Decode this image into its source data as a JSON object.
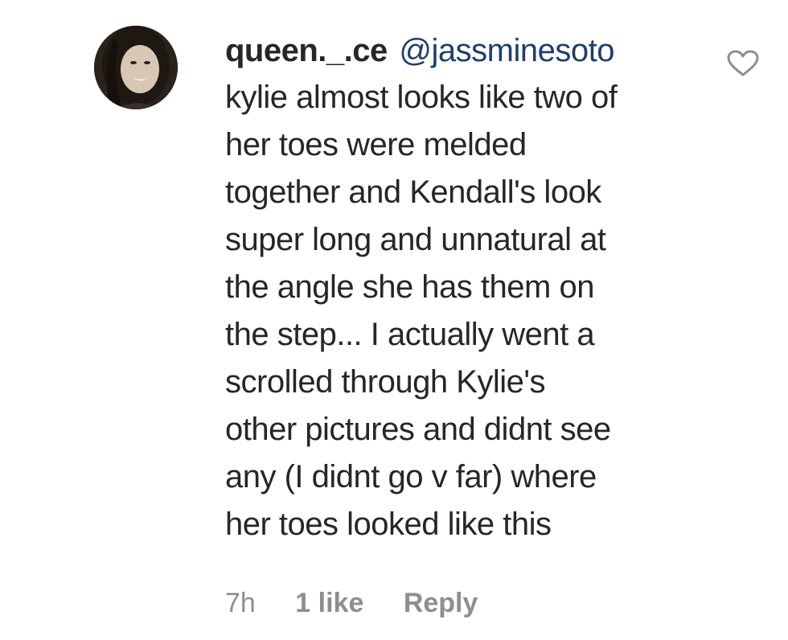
{
  "comment": {
    "username": "queen._.ce",
    "mention": "@jassminesoto",
    "text_lines": [
      "kylie almost looks like two of",
      "her toes were melded",
      "together and Kendall's look",
      "super long and unnatural at",
      "the angle she has them on",
      "the step... I actually went a",
      "scrolled through Kylie's",
      "other pictures and didnt see",
      "any (I didnt go v far) where",
      "her toes looked like this"
    ],
    "timestamp": "7h",
    "likes": "1 like",
    "reply_label": "Reply",
    "like_icon": "heart-outline-icon"
  },
  "colors": {
    "text": "#262626",
    "mention": "#1f3f6b",
    "meta": "#8e8e8e",
    "heart_stroke": "#8e8e8e"
  }
}
